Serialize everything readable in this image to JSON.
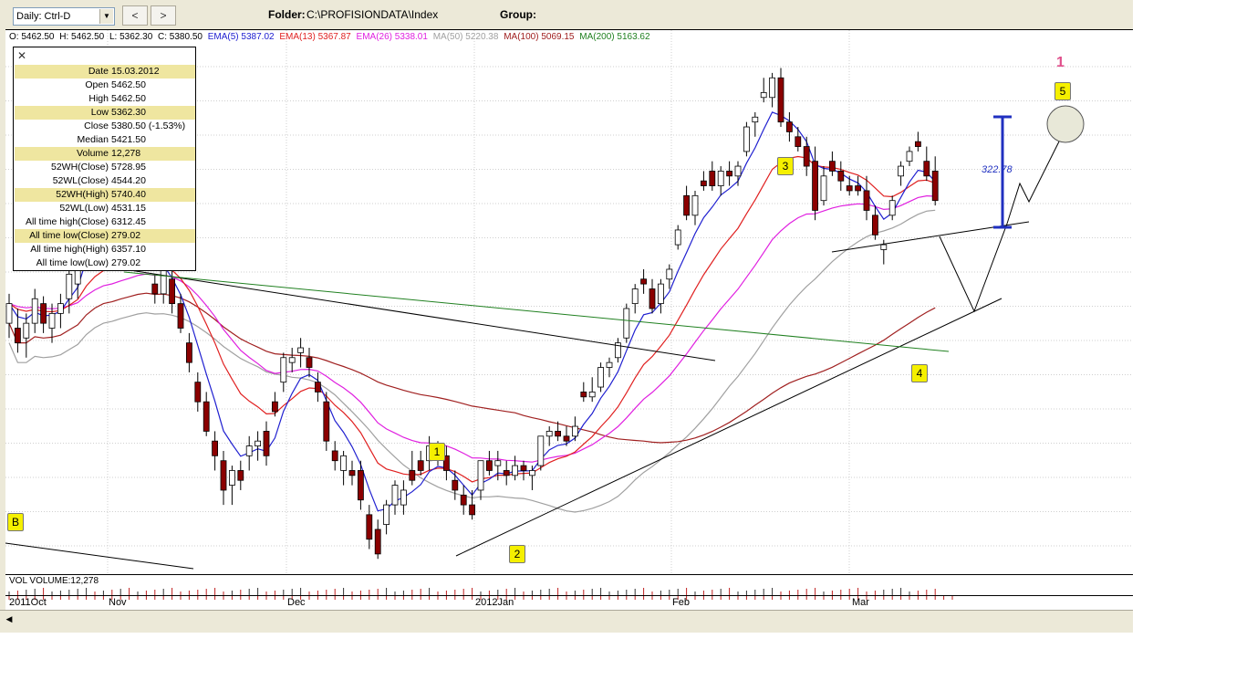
{
  "toolbar": {
    "period_select": "Daily: Ctrl-D",
    "prev_label": "<",
    "next_label": ">",
    "folder_label": "Folder:",
    "folder_value": "C:\\PROFISIONDATA\\Index",
    "group_label": "Group:"
  },
  "ohlc_line": {
    "open": "O: 5462.50",
    "high": "H: 5462.50",
    "low": "L: 5362.30",
    "close": "C: 5380.50",
    "ema5": "EMA(5) 5387.02",
    "ema13": "EMA(13) 5367.87",
    "ema26": "EMA(26) 5338.01",
    "ma50": "MA(50) 5220.38",
    "ma100": "MA(100) 5069.15",
    "ma200": "MA(200) 5163.62"
  },
  "colors": {
    "ema5": "#2020d0",
    "ema13": "#e02020",
    "ema26": "#e020e0",
    "ma50": "#a0a0a0",
    "ma100": "#a02020",
    "ma200": "#208020",
    "bear_candle": "#8b0000",
    "wave_label_bg": "#f5f000",
    "target_bar": "#2030c0"
  },
  "info_panel": {
    "close_icon": "close-icon",
    "rows": [
      {
        "key": "Date",
        "value": "15.03.2012"
      },
      {
        "key": "Open",
        "value": "5462.50"
      },
      {
        "key": "High",
        "value": "5462.50"
      },
      {
        "key": "Low",
        "value": "5362.30"
      },
      {
        "key": "Close",
        "value": "5380.50 (-1.53%)"
      },
      {
        "key": "Median",
        "value": "5421.50"
      },
      {
        "key": "Volume",
        "value": "12,278"
      },
      {
        "key": "52WH(Close)",
        "value": "5728.95"
      },
      {
        "key": "52WL(Close)",
        "value": "4544.20"
      },
      {
        "key": "52WH(High)",
        "value": "5740.40"
      },
      {
        "key": "52WL(Low)",
        "value": "4531.15"
      },
      {
        "key": "All time high(Close)",
        "value": "6312.45"
      },
      {
        "key": "All time low(Close)",
        "value": "279.02"
      },
      {
        "key": "All time high(High)",
        "value": "6357.10"
      },
      {
        "key": "All time low(Low)",
        "value": "279.02"
      }
    ]
  },
  "annotations": {
    "wave_b": "B",
    "wave_1": "1",
    "wave_2": "2",
    "wave_3": "3",
    "wave_4": "4",
    "wave_5": "5",
    "pink_one": "1",
    "target_value": "322.78"
  },
  "volume_panel": {
    "label": "VOL  VOLUME:12,278"
  },
  "time_axis": {
    "labels": [
      "2011Oct",
      "Nov",
      "Dec",
      "2012Jan",
      "Feb",
      "Mar"
    ]
  },
  "chart_data": {
    "type": "candlestick",
    "candles": [
      {
        "o": 5020,
        "h": 5080,
        "l": 4990,
        "c": 5060
      },
      {
        "o": 5010,
        "h": 5050,
        "l": 4960,
        "c": 4980
      },
      {
        "o": 4990,
        "h": 5040,
        "l": 4950,
        "c": 5020
      },
      {
        "o": 5020,
        "h": 5090,
        "l": 5000,
        "c": 5070
      },
      {
        "o": 5060,
        "h": 5075,
        "l": 5000,
        "c": 5020
      },
      {
        "o": 5010,
        "h": 5060,
        "l": 4980,
        "c": 5040
      },
      {
        "o": 5040,
        "h": 5080,
        "l": 5010,
        "c": 5060
      },
      {
        "o": 5070,
        "h": 5140,
        "l": 5040,
        "c": 5120
      },
      {
        "o": 5100,
        "h": 5180,
        "l": 5070,
        "c": 5140
      },
      {
        "o": 5250,
        "h": 5290,
        "l": 5220,
        "c": 5260
      },
      {
        "o": 5260,
        "h": 5270,
        "l": 5200,
        "c": 5230
      },
      {
        "o": 5180,
        "h": 5220,
        "l": 5140,
        "c": 5200
      },
      {
        "o": 5200,
        "h": 5230,
        "l": 5130,
        "c": 5150
      },
      {
        "o": 5160,
        "h": 5200,
        "l": 5130,
        "c": 5180
      },
      {
        "o": 5220,
        "h": 5240,
        "l": 5160,
        "c": 5180
      },
      {
        "o": 5180,
        "h": 5210,
        "l": 5130,
        "c": 5190
      },
      {
        "o": 5210,
        "h": 5220,
        "l": 5150,
        "c": 5160
      },
      {
        "o": 5100,
        "h": 5120,
        "l": 5060,
        "c": 5080
      },
      {
        "o": 5080,
        "h": 5140,
        "l": 5060,
        "c": 5130
      },
      {
        "o": 5110,
        "h": 5130,
        "l": 5040,
        "c": 5060
      },
      {
        "o": 5060,
        "h": 5080,
        "l": 5000,
        "c": 5010
      },
      {
        "o": 4980,
        "h": 5000,
        "l": 4920,
        "c": 4940
      },
      {
        "o": 4900,
        "h": 4920,
        "l": 4840,
        "c": 4860
      },
      {
        "o": 4860,
        "h": 4880,
        "l": 4790,
        "c": 4800
      },
      {
        "o": 4780,
        "h": 4800,
        "l": 4720,
        "c": 4750
      },
      {
        "o": 4740,
        "h": 4760,
        "l": 4650,
        "c": 4680
      },
      {
        "o": 4690,
        "h": 4730,
        "l": 4650,
        "c": 4720
      },
      {
        "o": 4720,
        "h": 4740,
        "l": 4680,
        "c": 4700
      },
      {
        "o": 4750,
        "h": 4790,
        "l": 4720,
        "c": 4770
      },
      {
        "o": 4770,
        "h": 4800,
        "l": 4740,
        "c": 4780
      },
      {
        "o": 4800,
        "h": 4820,
        "l": 4730,
        "c": 4750
      },
      {
        "o": 4860,
        "h": 4880,
        "l": 4830,
        "c": 4840
      },
      {
        "o": 4900,
        "h": 4960,
        "l": 4880,
        "c": 4950
      },
      {
        "o": 4940,
        "h": 4970,
        "l": 4920,
        "c": 4950
      },
      {
        "o": 4960,
        "h": 4990,
        "l": 4930,
        "c": 4970
      },
      {
        "o": 4950,
        "h": 4970,
        "l": 4910,
        "c": 4930
      },
      {
        "o": 4900,
        "h": 4920,
        "l": 4860,
        "c": 4880
      },
      {
        "o": 4860,
        "h": 4880,
        "l": 4760,
        "c": 4780
      },
      {
        "o": 4760,
        "h": 4780,
        "l": 4720,
        "c": 4740
      },
      {
        "o": 4720,
        "h": 4760,
        "l": 4690,
        "c": 4750
      },
      {
        "o": 4720,
        "h": 4740,
        "l": 4690,
        "c": 4710
      },
      {
        "o": 4720,
        "h": 4740,
        "l": 4640,
        "c": 4660
      },
      {
        "o": 4630,
        "h": 4650,
        "l": 4560,
        "c": 4580
      },
      {
        "o": 4600,
        "h": 4620,
        "l": 4540,
        "c": 4550
      },
      {
        "o": 4610,
        "h": 4660,
        "l": 4590,
        "c": 4650
      },
      {
        "o": 4650,
        "h": 4700,
        "l": 4630,
        "c": 4690
      },
      {
        "o": 4650,
        "h": 4700,
        "l": 4630,
        "c": 4680
      },
      {
        "o": 4720,
        "h": 4760,
        "l": 4690,
        "c": 4700
      },
      {
        "o": 4740,
        "h": 4760,
        "l": 4710,
        "c": 4720
      },
      {
        "o": 4740,
        "h": 4790,
        "l": 4720,
        "c": 4770
      },
      {
        "o": 4760,
        "h": 4780,
        "l": 4730,
        "c": 4750
      },
      {
        "o": 4750,
        "h": 4770,
        "l": 4700,
        "c": 4720
      },
      {
        "o": 4700,
        "h": 4720,
        "l": 4660,
        "c": 4680
      },
      {
        "o": 4670,
        "h": 4690,
        "l": 4630,
        "c": 4650
      },
      {
        "o": 4650,
        "h": 4680,
        "l": 4620,
        "c": 4630
      },
      {
        "o": 4680,
        "h": 4740,
        "l": 4660,
        "c": 4740
      },
      {
        "o": 4740,
        "h": 4760,
        "l": 4710,
        "c": 4720
      },
      {
        "o": 4730,
        "h": 4760,
        "l": 4700,
        "c": 4740
      },
      {
        "o": 4720,
        "h": 4740,
        "l": 4690,
        "c": 4710
      },
      {
        "o": 4710,
        "h": 4750,
        "l": 4700,
        "c": 4730
      },
      {
        "o": 4730,
        "h": 4740,
        "l": 4700,
        "c": 4720
      },
      {
        "o": 4710,
        "h": 4730,
        "l": 4680,
        "c": 4720
      },
      {
        "o": 4730,
        "h": 4790,
        "l": 4720,
        "c": 4790
      },
      {
        "o": 4790,
        "h": 4810,
        "l": 4770,
        "c": 4800
      },
      {
        "o": 4800,
        "h": 4820,
        "l": 4780,
        "c": 4790
      },
      {
        "o": 4790,
        "h": 4810,
        "l": 4770,
        "c": 4780
      },
      {
        "o": 4790,
        "h": 4830,
        "l": 4780,
        "c": 4810
      },
      {
        "o": 4880,
        "h": 4900,
        "l": 4860,
        "c": 4870
      },
      {
        "o": 4870,
        "h": 4910,
        "l": 4860,
        "c": 4880
      },
      {
        "o": 4890,
        "h": 4940,
        "l": 4880,
        "c": 4930
      },
      {
        "o": 4930,
        "h": 4950,
        "l": 4910,
        "c": 4940
      },
      {
        "o": 4950,
        "h": 4990,
        "l": 4940,
        "c": 4980
      },
      {
        "o": 4990,
        "h": 5060,
        "l": 4980,
        "c": 5050
      },
      {
        "o": 5060,
        "h": 5100,
        "l": 5040,
        "c": 5090
      },
      {
        "o": 5110,
        "h": 5130,
        "l": 5080,
        "c": 5100
      },
      {
        "o": 5090,
        "h": 5110,
        "l": 5040,
        "c": 5050
      },
      {
        "o": 5060,
        "h": 5110,
        "l": 5040,
        "c": 5100
      },
      {
        "o": 5110,
        "h": 5140,
        "l": 5090,
        "c": 5130
      },
      {
        "o": 5180,
        "h": 5220,
        "l": 5170,
        "c": 5210
      },
      {
        "o": 5280,
        "h": 5300,
        "l": 5230,
        "c": 5240
      },
      {
        "o": 5240,
        "h": 5290,
        "l": 5220,
        "c": 5280
      },
      {
        "o": 5310,
        "h": 5330,
        "l": 5290,
        "c": 5300
      },
      {
        "o": 5330,
        "h": 5350,
        "l": 5290,
        "c": 5300
      },
      {
        "o": 5300,
        "h": 5340,
        "l": 5280,
        "c": 5330
      },
      {
        "o": 5330,
        "h": 5350,
        "l": 5300,
        "c": 5320
      },
      {
        "o": 5320,
        "h": 5350,
        "l": 5300,
        "c": 5340
      },
      {
        "o": 5370,
        "h": 5430,
        "l": 5360,
        "c": 5420
      },
      {
        "o": 5430,
        "h": 5450,
        "l": 5400,
        "c": 5440
      },
      {
        "o": 5480,
        "h": 5520,
        "l": 5470,
        "c": 5490
      },
      {
        "o": 5480,
        "h": 5530,
        "l": 5460,
        "c": 5520
      },
      {
        "o": 5520,
        "h": 5540,
        "l": 5420,
        "c": 5430
      },
      {
        "o": 5430,
        "h": 5450,
        "l": 5390,
        "c": 5410
      },
      {
        "o": 5400,
        "h": 5420,
        "l": 5370,
        "c": 5380
      },
      {
        "o": 5380,
        "h": 5400,
        "l": 5320,
        "c": 5340
      },
      {
        "o": 5350,
        "h": 5380,
        "l": 5230,
        "c": 5250
      },
      {
        "o": 5270,
        "h": 5340,
        "l": 5260,
        "c": 5320
      },
      {
        "o": 5350,
        "h": 5370,
        "l": 5320,
        "c": 5330
      },
      {
        "o": 5330,
        "h": 5350,
        "l": 5290,
        "c": 5310
      },
      {
        "o": 5300,
        "h": 5320,
        "l": 5280,
        "c": 5290
      },
      {
        "o": 5300,
        "h": 5320,
        "l": 5280,
        "c": 5290
      },
      {
        "o": 5290,
        "h": 5320,
        "l": 5230,
        "c": 5250
      },
      {
        "o": 5240,
        "h": 5260,
        "l": 5190,
        "c": 5200
      },
      {
        "o": 5170,
        "h": 5190,
        "l": 5140,
        "c": 5180
      },
      {
        "o": 5240,
        "h": 5280,
        "l": 5230,
        "c": 5270
      },
      {
        "o": 5320,
        "h": 5350,
        "l": 5300,
        "c": 5340
      },
      {
        "o": 5350,
        "h": 5380,
        "l": 5340,
        "c": 5370
      },
      {
        "o": 5390,
        "h": 5410,
        "l": 5370,
        "c": 5380
      },
      {
        "o": 5350,
        "h": 5380,
        "l": 5310,
        "c": 5320
      },
      {
        "o": 5330,
        "h": 5360,
        "l": 5260,
        "c": 5270
      }
    ]
  }
}
